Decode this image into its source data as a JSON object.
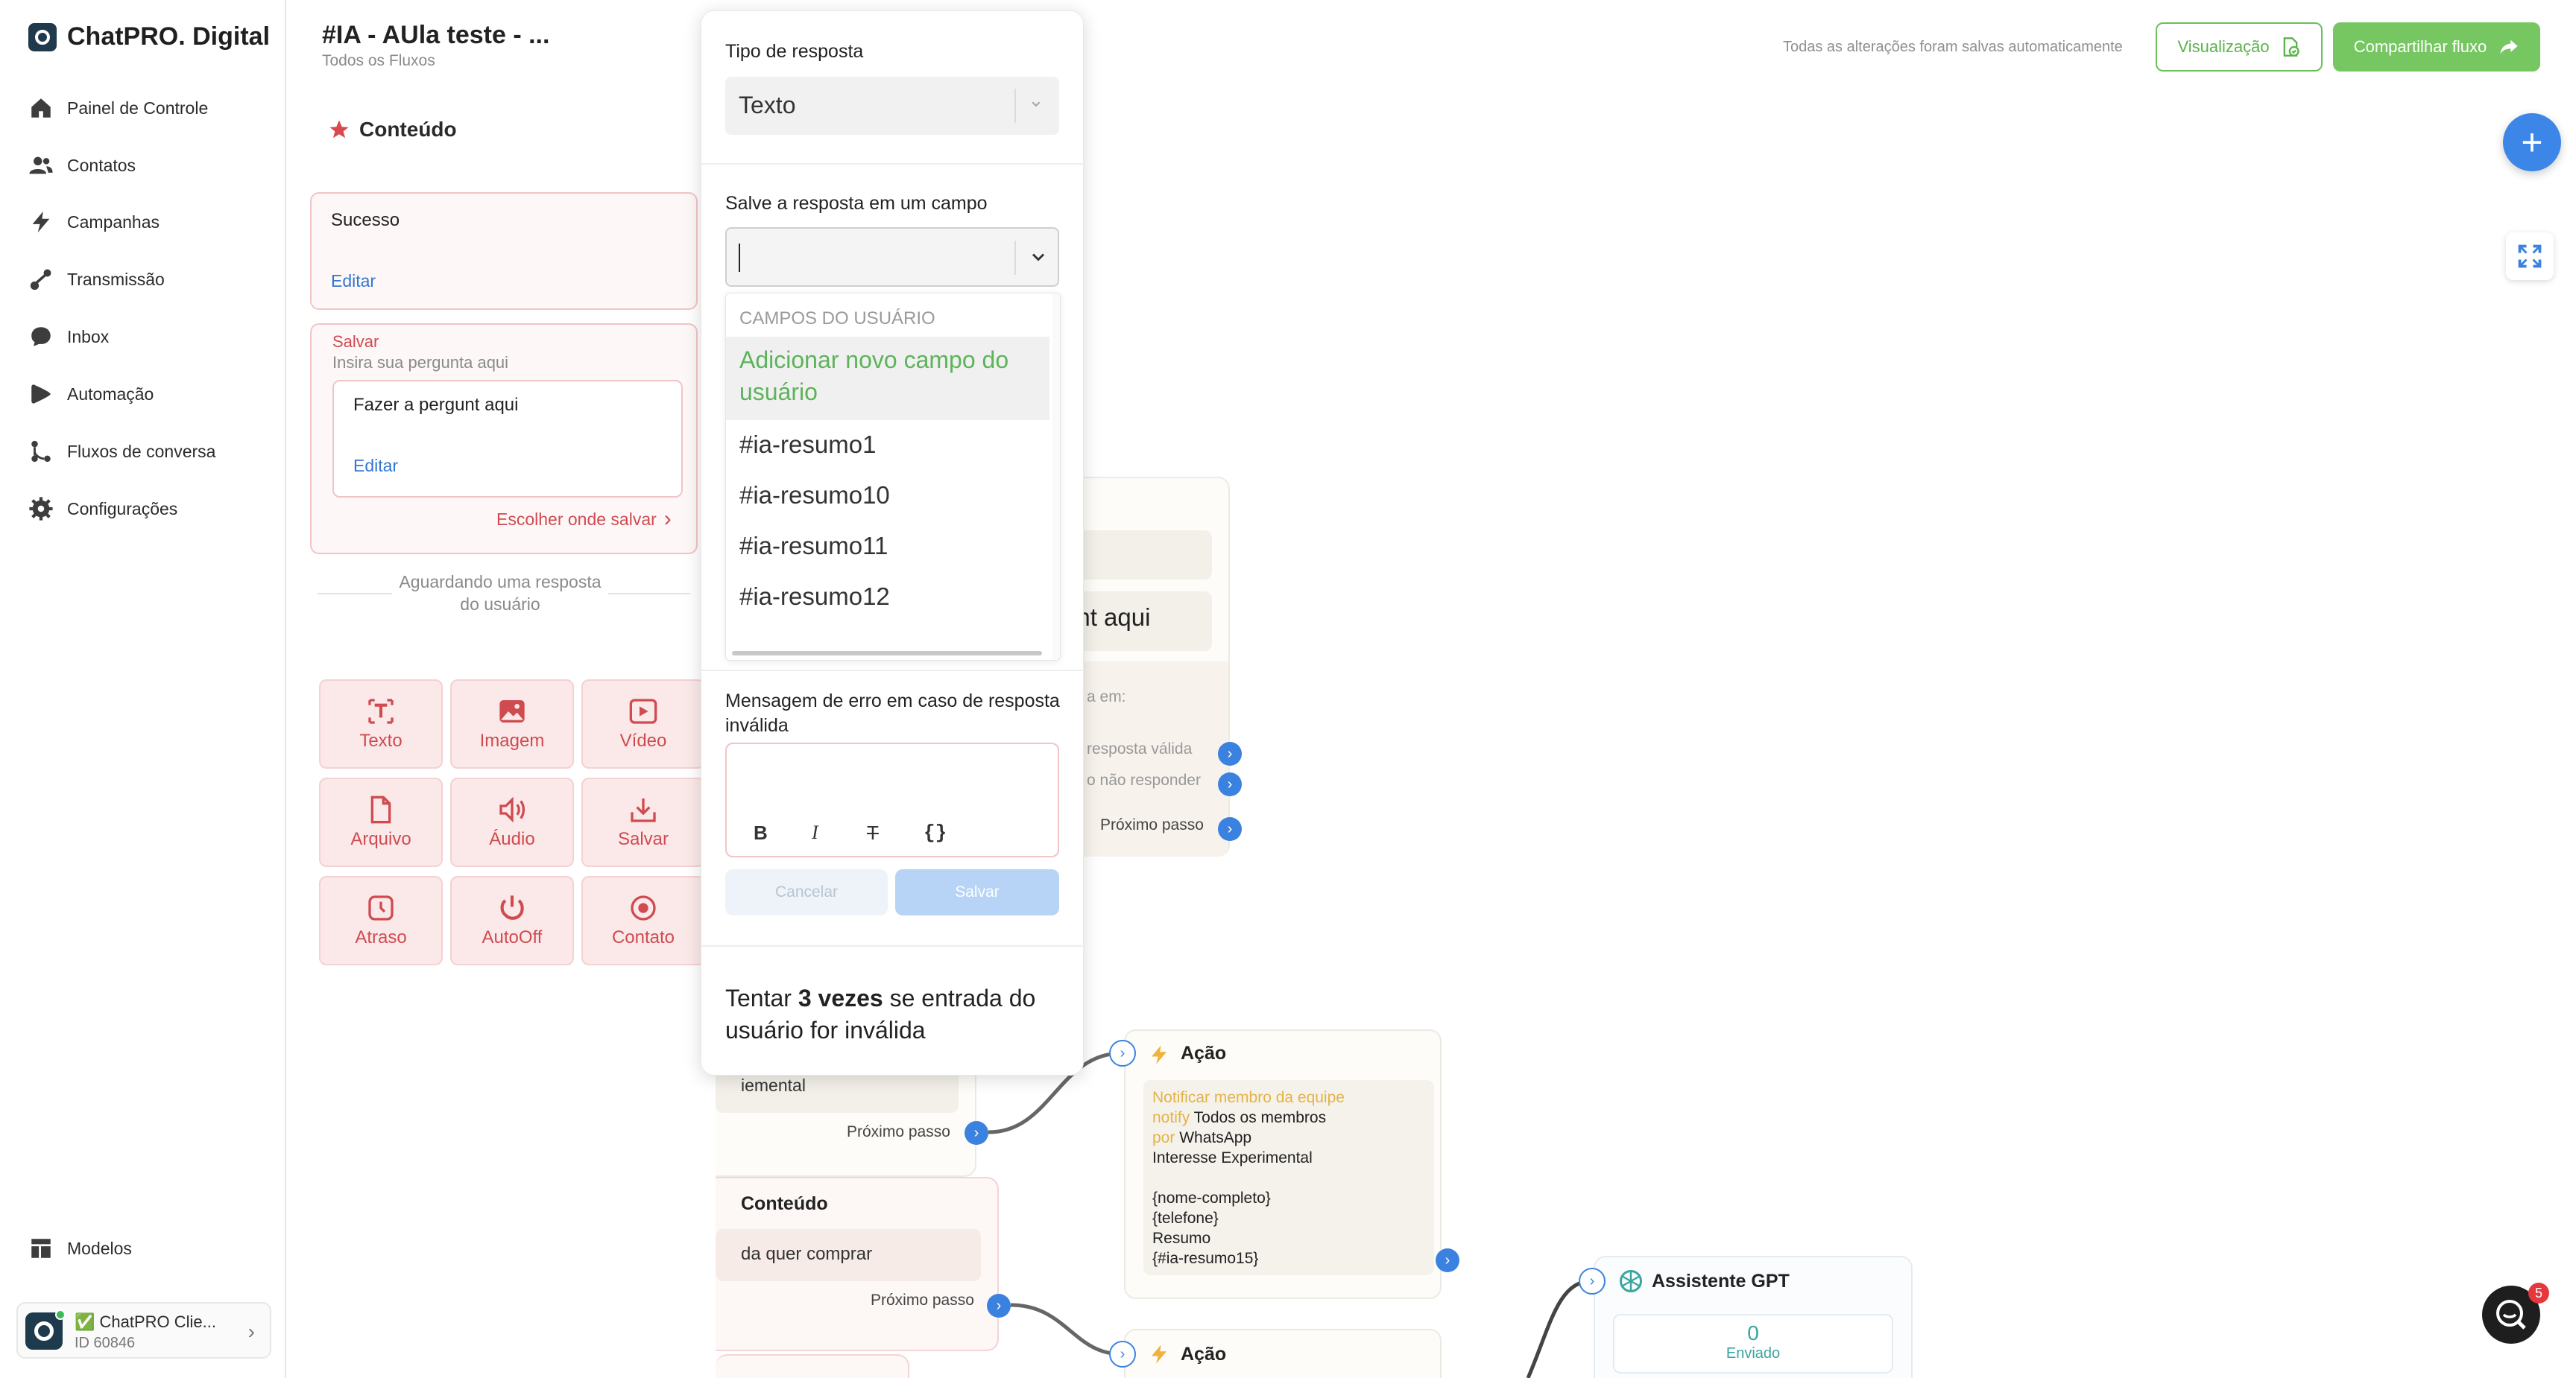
{
  "app": {
    "brand": "ChatPRO. Digital"
  },
  "sidebar": {
    "items": [
      {
        "label": "Painel de Controle",
        "icon": "home-icon"
      },
      {
        "label": "Contatos",
        "icon": "users-icon"
      },
      {
        "label": "Campanhas",
        "icon": "bolt-icon"
      },
      {
        "label": "Transmissão",
        "icon": "broadcast-icon"
      },
      {
        "label": "Inbox",
        "icon": "chat-bubble-icon"
      },
      {
        "label": "Automação",
        "icon": "automation-icon"
      },
      {
        "label": "Fluxos de conversa",
        "icon": "flow-icon"
      },
      {
        "label": "Configurações",
        "icon": "gear-icon"
      }
    ],
    "templates_label": "Modelos",
    "workspace": {
      "name": "✅ ChatPRO Clie...",
      "id": "ID 60846"
    }
  },
  "header": {
    "title": "#IA - AUla teste - ...",
    "breadcrumb": "Todos os Fluxos",
    "autosave": "Todas as alterações foram salvas automaticamente",
    "preview_label": "Visualização",
    "share_label": "Compartilhar fluxo"
  },
  "content_panel": {
    "title": "Conteúdo",
    "success_card": {
      "text": "Sucesso",
      "edit": "Editar"
    },
    "save_card": {
      "label": "Salvar",
      "placeholder": "Insira sua pergunta aqui",
      "question": "Fazer a pergunt aqui",
      "edit": "Editar",
      "choose_save": "Escolher onde salvar"
    },
    "waiting_text": "Aguardando uma resposta do usuário",
    "tools": [
      "Texto",
      "Imagem",
      "Vídeo",
      "Arquivo",
      "Áudio",
      "Salvar",
      "Atraso",
      "AutoOff",
      "Contato"
    ]
  },
  "popup": {
    "response_type_label": "Tipo de resposta",
    "response_type_value": "Texto",
    "save_field_label": "Salve a resposta em um campo",
    "dropdown": {
      "group": "CAMPOS DO USUÁRIO",
      "add_new": "Adicionar novo campo do usuário",
      "options": [
        "#ia-resumo1",
        "#ia-resumo10",
        "#ia-resumo11",
        "#ia-resumo12"
      ]
    },
    "error_label": "Mensagem de erro em caso de resposta inválida",
    "cancel": "Cancelar",
    "save": "Salvar",
    "retry_prefix": "Tentar ",
    "retry_count": "3 vezes",
    "retry_suffix": " se entrada do usuário for inválida"
  },
  "canvas": {
    "partial_node": {
      "question_fragment": "unt aqui",
      "save_in": "a em:",
      "valid": "resposta válida",
      "no_reply": "o não responder",
      "next": "Próximo passo"
    },
    "node_left_top": {
      "text": "iemental",
      "next": "Próximo passo"
    },
    "node_content": {
      "title": "Conteúdo",
      "text": "da quer comprar",
      "next": "Próximo passo"
    },
    "action1": {
      "title": "Ação",
      "heading": "Notificar membro da equipe",
      "notify_kw": "notify",
      "notify_val": "Todos os membros",
      "por_kw": "por",
      "por_val": "WhatsApp",
      "line1": "Interesse Experimental",
      "line2": "{nome-completo}",
      "line3": "{telefone}",
      "line4": "Resumo",
      "line5": "{#ia-resumo15}"
    },
    "action2": {
      "title": "Ação"
    },
    "gpt": {
      "title": "Assistente GPT",
      "count": "0",
      "count_label": "Enviado"
    },
    "chat_badge": "5"
  },
  "colors": {
    "accent_blue": "#3b82e0",
    "brand_green": "#76c661",
    "danger_red": "#d04a50",
    "option_green": "#5db35a"
  }
}
